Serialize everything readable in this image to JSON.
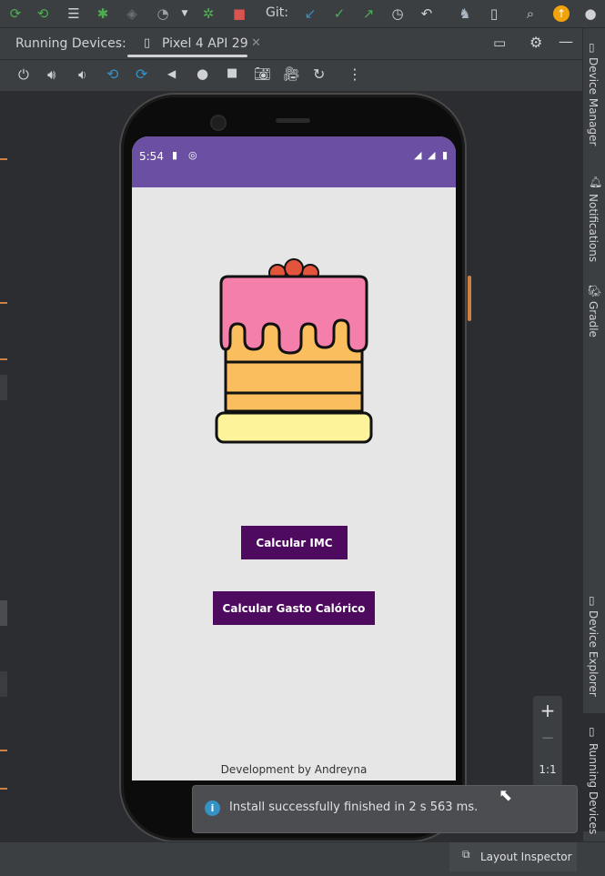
{
  "toolbar": {
    "git_label": "Git:",
    "icons": [
      "sync-icon",
      "sync-all-icon",
      "list-icon",
      "debug-icon",
      "profiler-icon",
      "performance-icon",
      "dropdown-icon",
      "bug-icon",
      "stop-icon",
      "update-icon",
      "check-icon",
      "push-icon",
      "history-icon",
      "undo-icon",
      "android-icon",
      "device-icon",
      "search-icon",
      "update-available-icon",
      "account-icon"
    ]
  },
  "tabs": {
    "panel_title": "Running Devices:",
    "device_tab": "Pixel 4 API 29"
  },
  "device_controls": [
    "power-icon",
    "volume-up-icon",
    "volume-down-icon",
    "rotate-left-icon",
    "rotate-right-icon",
    "back-icon",
    "home-icon",
    "overview-icon",
    "screenshot-icon",
    "record-icon",
    "reset-icon",
    "more-icon"
  ],
  "right_sidebar": {
    "device_manager": "Device Manager",
    "notifications": "Notifications",
    "gradle": "Gradle",
    "device_explorer": "Device Explorer",
    "running_devices": "Running Devices"
  },
  "phone": {
    "time": "5:54",
    "button_imc": "Calcular IMC",
    "button_gasto": "Calcular Gasto Calórico",
    "footer": "Development by Andreyna"
  },
  "zoom": {
    "plus": "+",
    "minus": "−",
    "one_to_one": "1:1"
  },
  "toast": {
    "message": "Install successfully finished in 2 s 563 ms."
  },
  "statusbar": {
    "layout_inspector": "Layout Inspector"
  },
  "colors": {
    "status_bar": "#6a4fa3",
    "button": "#4e0a5e",
    "frosting": "#f47fab",
    "cake": "#fbbe5e",
    "base": "#fdf39b",
    "cherry": "#e2543c"
  }
}
